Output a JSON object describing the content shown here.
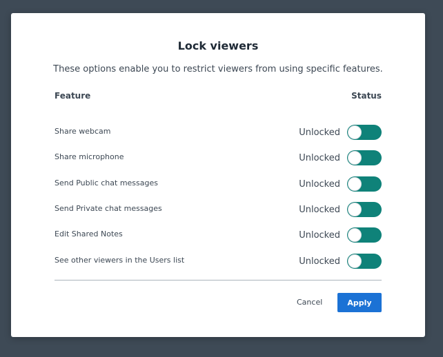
{
  "modal": {
    "title": "Lock viewers",
    "subtitle": "These options enable you to restrict viewers from using specific features."
  },
  "columns": {
    "feature": "Feature",
    "status": "Status"
  },
  "rows": [
    {
      "label": "Share webcam",
      "status": "Unlocked"
    },
    {
      "label": "Share microphone",
      "status": "Unlocked"
    },
    {
      "label": "Send Public chat messages",
      "status": "Unlocked"
    },
    {
      "label": "Send Private chat messages",
      "status": "Unlocked"
    },
    {
      "label": "Edit Shared Notes",
      "status": "Unlocked"
    },
    {
      "label": "See other viewers in the Users list",
      "status": "Unlocked"
    }
  ],
  "actions": {
    "cancel_label": "Cancel",
    "apply_label": "Apply"
  },
  "colors": {
    "backdrop": "#3e4a56",
    "toggle_on": "#0f8279",
    "apply_button": "#1b72d5"
  }
}
